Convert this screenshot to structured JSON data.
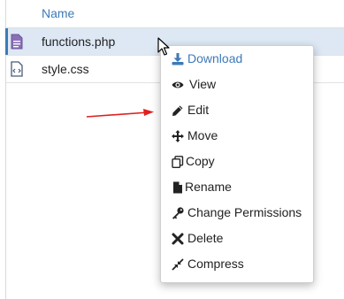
{
  "table": {
    "header_name": "Name",
    "rows": [
      {
        "name": "functions.php",
        "icon": "php-file-icon"
      },
      {
        "name": "style.css",
        "icon": "code-file-icon"
      }
    ]
  },
  "context_menu": {
    "items": [
      {
        "label": "Download",
        "icon": "download-icon"
      },
      {
        "label": "View",
        "icon": "eye-icon"
      },
      {
        "label": "Edit",
        "icon": "pencil-icon"
      },
      {
        "label": "Move",
        "icon": "move-arrows-icon"
      },
      {
        "label": "Copy",
        "icon": "copy-icon"
      },
      {
        "label": "Rename",
        "icon": "file-icon"
      },
      {
        "label": "Change Permissions",
        "icon": "key-icon"
      },
      {
        "label": "Delete",
        "icon": "x-icon"
      },
      {
        "label": "Compress",
        "icon": "compress-icon"
      }
    ]
  },
  "colors": {
    "accent": "#3d7ab8",
    "selected_row": "#dde8f4",
    "annotation_arrow": "#e02020"
  }
}
